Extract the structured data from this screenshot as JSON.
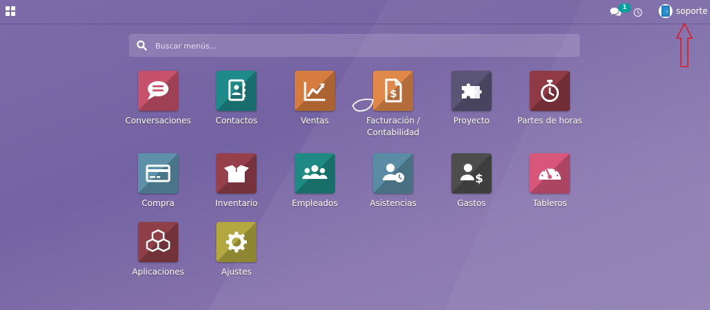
{
  "topbar": {
    "chat_badge": "1",
    "user_name": "soporte"
  },
  "search": {
    "placeholder": "Buscar menús..."
  },
  "apps": [
    {
      "label": "Conversaciones",
      "color": "#c7506a",
      "icon": "chat-bubble-icon"
    },
    {
      "label": "Contactos",
      "color": "#1e8a8a",
      "icon": "address-book-icon"
    },
    {
      "label": "Ventas",
      "color": "#d77c3f",
      "icon": "trending-up-chart-icon"
    },
    {
      "label": "Facturación / Contabilidad",
      "color": "#e0884a",
      "icon": "invoice-dollar-icon"
    },
    {
      "label": "Proyecto",
      "color": "#5a5577",
      "icon": "puzzle-piece-icon"
    },
    {
      "label": "Partes de horas",
      "color": "#8f3a45",
      "icon": "stopwatch-icon"
    },
    {
      "label": "Compra",
      "color": "#5d91a9",
      "icon": "credit-card-icon"
    },
    {
      "label": "Inventario",
      "color": "#95404a",
      "icon": "open-box-icon"
    },
    {
      "label": "Empleados",
      "color": "#1e8a83",
      "icon": "people-group-icon"
    },
    {
      "label": "Asistencias",
      "color": "#5a8da5",
      "icon": "user-clock-icon"
    },
    {
      "label": "Gastos",
      "color": "#4d4d4d",
      "icon": "user-dollar-icon"
    },
    {
      "label": "Tableros",
      "color": "#d7567a",
      "icon": "speedometer-icon"
    },
    {
      "label": "Aplicaciones",
      "color": "#8e3f48",
      "icon": "cubes-icon"
    },
    {
      "label": "Ajustes",
      "color": "#b3a83f",
      "icon": "gear-icon"
    }
  ],
  "colors": {
    "background": "#7d6aa8",
    "badge": "#00a09d",
    "annotation_arrow": "#e3181e"
  }
}
